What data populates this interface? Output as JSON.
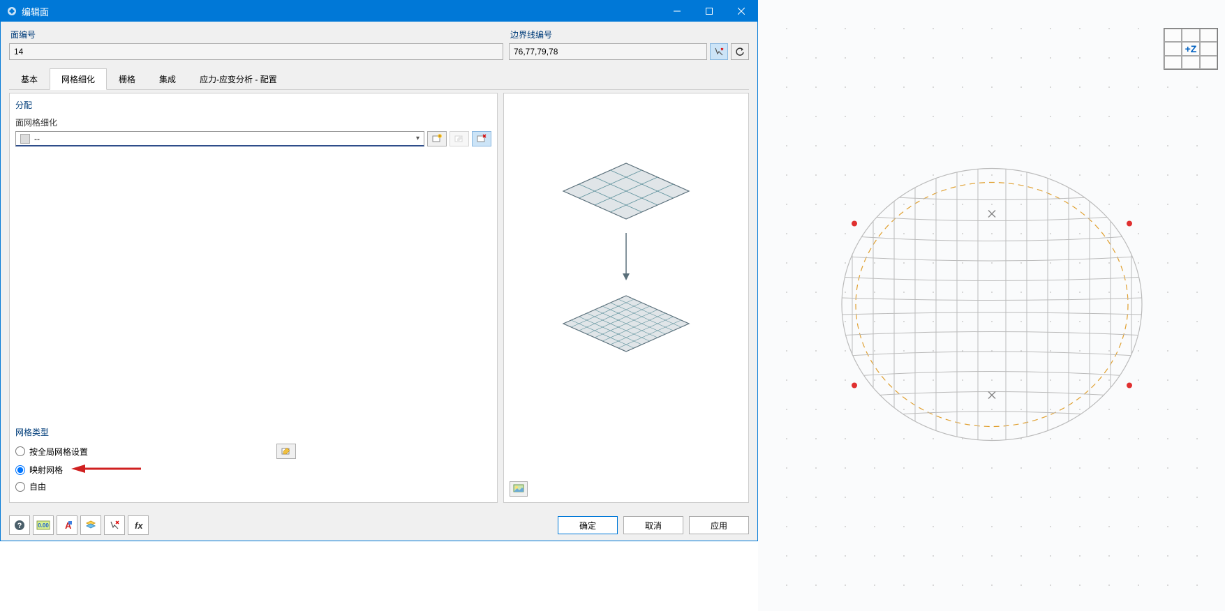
{
  "titlebar": {
    "title": "编辑面"
  },
  "inputs": {
    "surface_number_label": "面编号",
    "surface_number_value": "14",
    "boundary_lines_label": "边界线编号",
    "boundary_lines_value": "76,77,79,78"
  },
  "tabs": {
    "basic": "基本",
    "mesh_refinement": "网格细化",
    "grid": "栅格",
    "integration": "集成",
    "stress_analysis": "应力-应变分析 - 配置"
  },
  "assignment": {
    "title": "分配",
    "label": "面网格细化",
    "dropdown_value": "--"
  },
  "mesh_type": {
    "title": "网格类型",
    "global": "按全局网格设置",
    "mapped": "映射网格",
    "free": "自由"
  },
  "buttons": {
    "ok": "确定",
    "cancel": "取消",
    "apply": "应用"
  },
  "viewcube": {
    "label": "+Z"
  }
}
